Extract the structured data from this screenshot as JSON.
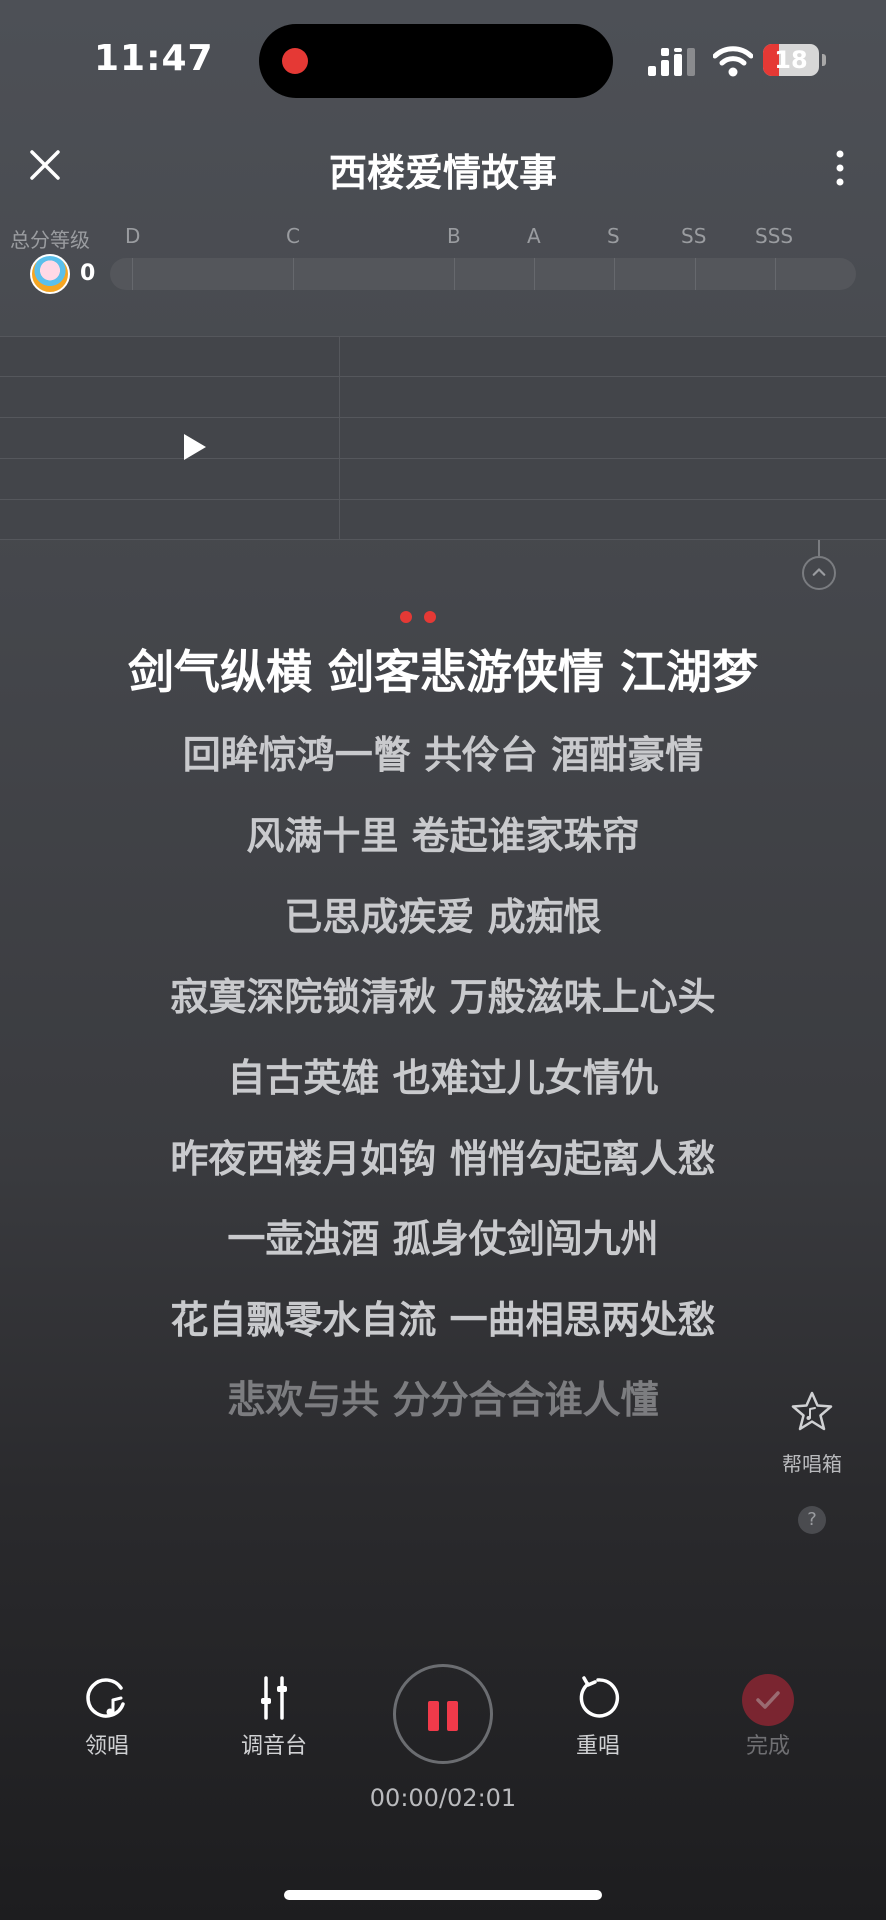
{
  "status_bar": {
    "time": "11:47",
    "battery": "18",
    "icons": [
      "recording-dot-icon",
      "cellular-signal-icon",
      "wifi-icon",
      "battery-icon"
    ]
  },
  "header": {
    "title": "西楼爱情故事",
    "icons": [
      "close-icon",
      "more-vertical-icon"
    ]
  },
  "grade": {
    "label": "总分等级",
    "levels": [
      "D",
      "C",
      "B",
      "A",
      "S",
      "SS",
      "SSS"
    ],
    "score": "0"
  },
  "lyrics": {
    "current": "剑气纵横 剑客悲游侠情 江湖梦",
    "lines": [
      "回眸惊鸿一瞥 共伶台 酒酣豪情",
      "风满十里 卷起谁家珠帘",
      "已思成疾爱 成痴恨",
      "寂寞深院锁清秋 万般滋味上心头",
      "自古英雄 也难过儿女情仇",
      "昨夜西楼月如钩 悄悄勾起离人愁",
      "一壶浊酒  孤身仗剑闯九州",
      "花自飘零水自流  一曲相思两处愁",
      "悲欢与共 分分合合谁人懂"
    ]
  },
  "helper": {
    "label": "帮唱箱",
    "help_mark": "?"
  },
  "controls": {
    "lead_vocal": "领唱",
    "mixer": "调音台",
    "restart": "重唱",
    "done": "完成"
  },
  "timer": "00:00/02:01",
  "colors": {
    "accent_red": "#e53935",
    "pause_red": "#f03a4a",
    "done_disabled": "#7a2530"
  }
}
